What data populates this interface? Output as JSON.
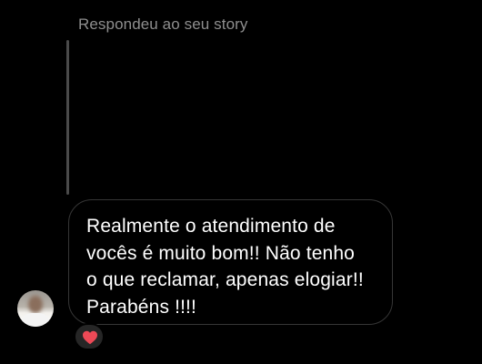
{
  "reply_header": {
    "text": "Respondeu ao seu story"
  },
  "message": {
    "text": "Realmente o atendimento de\nvocês é muito bom!! Não tenho\no que reclamar, apenas elogiar!!\nParabéns !!!!"
  },
  "reaction": {
    "icon": "heart-icon",
    "color": "#ed4956"
  },
  "colors": {
    "background": "#000000",
    "header_text": "#8e8e8e",
    "bubble_border": "#363636",
    "message_text": "#ffffff",
    "reaction_bg": "#262626"
  }
}
